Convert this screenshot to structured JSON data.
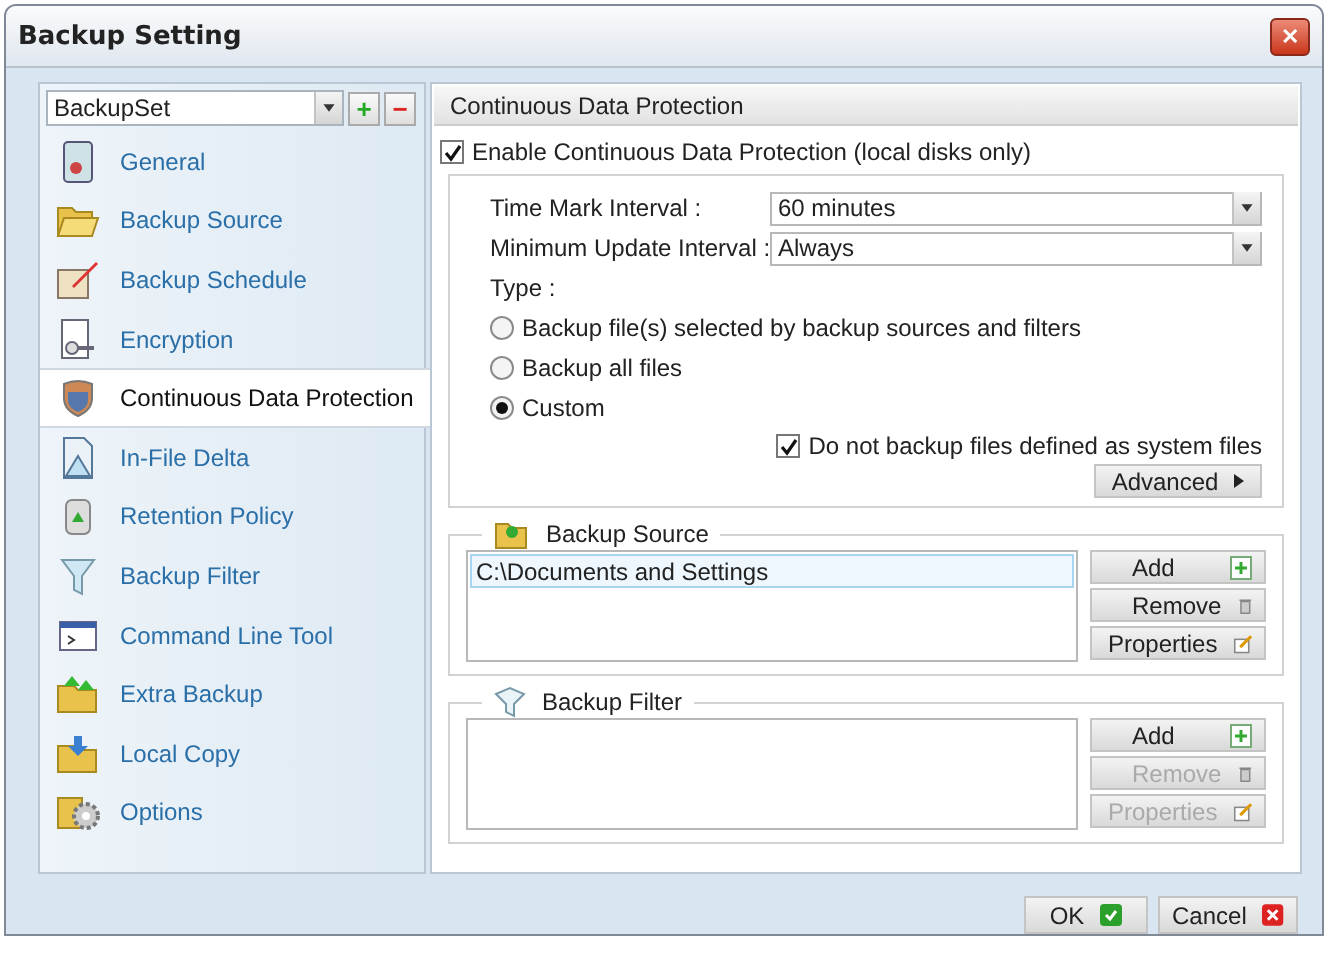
{
  "window": {
    "title": "Backup Setting",
    "close": "✕"
  },
  "sidebar": {
    "backup_set": "BackupSet",
    "add": "+",
    "remove": "−",
    "items": [
      {
        "label": "General",
        "selected": false
      },
      {
        "label": "Backup Source",
        "selected": false
      },
      {
        "label": "Backup Schedule",
        "selected": false
      },
      {
        "label": "Encryption",
        "selected": false
      },
      {
        "label": "Continuous Data Protection",
        "selected": true
      },
      {
        "label": "In-File Delta",
        "selected": false
      },
      {
        "label": "Retention Policy",
        "selected": false
      },
      {
        "label": "Backup Filter",
        "selected": false
      },
      {
        "label": "Command Line Tool",
        "selected": false
      },
      {
        "label": "Extra Backup",
        "selected": false
      },
      {
        "label": "Local Copy",
        "selected": false
      },
      {
        "label": "Options",
        "selected": false
      }
    ]
  },
  "panel": {
    "title": "Continuous Data Protection",
    "enable": {
      "label": "Enable Continuous Data Protection (local disks only)",
      "checked": true
    },
    "fields": [
      {
        "label": "Time Mark Interval :",
        "value": "60 minutes"
      },
      {
        "label": "Minimum Update Interval :",
        "value": "Always"
      }
    ],
    "type_label": "Type :",
    "types": [
      {
        "label": "Backup file(s) selected by backup sources and filters",
        "selected": false
      },
      {
        "label": "Backup all files",
        "selected": false
      },
      {
        "label": "Custom",
        "selected": true
      }
    ],
    "system_files": {
      "label": "Do not backup files defined as system files",
      "checked": true
    },
    "advanced": "Advanced",
    "groups": [
      {
        "title": "Backup Source",
        "entries": [
          {
            "text": "C:\\Documents and Settings",
            "selected": true
          }
        ],
        "buttons": [
          {
            "label": "Add",
            "disabled": false
          },
          {
            "label": "Remove",
            "disabled": false
          },
          {
            "label": "Properties",
            "disabled": false
          }
        ]
      },
      {
        "title": "Backup Filter",
        "buttons": [
          {
            "label": "Add",
            "disabled": false
          },
          {
            "label": "Remove",
            "disabled": true
          },
          {
            "label": "Properties",
            "disabled": true
          }
        ]
      }
    ]
  },
  "footer": {
    "buttons": [
      {
        "label": "OK",
        "kind": "ok"
      },
      {
        "label": "Cancel",
        "kind": "cancel"
      }
    ]
  }
}
